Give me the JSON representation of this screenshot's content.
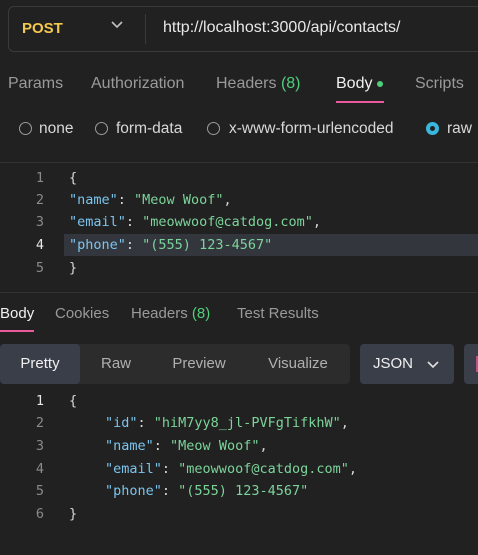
{
  "request": {
    "method": "POST",
    "url": "http://localhost:3000/api/contacts/"
  },
  "request_tabs": {
    "params": "Params",
    "authorization": "Authorization",
    "headers": "Headers",
    "headers_count": "(8)",
    "body": "Body",
    "scripts": "Scripts"
  },
  "body_types": {
    "none": "none",
    "form_data": "form-data",
    "urlencoded": "x-www-form-urlencoded",
    "raw": "raw",
    "selected": "raw"
  },
  "request_body": {
    "line_numbers": [
      "1",
      "2",
      "3",
      "4",
      "5"
    ],
    "open": "{",
    "name_key": "\"name\"",
    "name_val": "\"Meow Woof\"",
    "email_key": "\"email\"",
    "email_val": "\"meowwoof@catdog.com\"",
    "phone_key": "\"phone\"",
    "phone_val": "\"(555) 123-4567\"",
    "close": "}"
  },
  "response_tabs": {
    "body": "Body",
    "cookies": "Cookies",
    "headers": "Headers",
    "headers_count": "(8)",
    "test_results": "Test Results"
  },
  "view_modes": {
    "pretty": "Pretty",
    "raw": "Raw",
    "preview": "Preview",
    "visualize": "Visualize",
    "selected": "Pretty",
    "format": "JSON"
  },
  "response_body": {
    "line_numbers": [
      "1",
      "2",
      "3",
      "4",
      "5",
      "6"
    ],
    "open": "{",
    "id_key": "\"id\"",
    "id_val": "\"hiM7yy8_jl-PVFgTifkhW\"",
    "name_key": "\"name\"",
    "name_val": "\"Meow Woof\"",
    "email_key": "\"email\"",
    "email_val": "\"meowwoof@catdog.com\"",
    "phone_key": "\"phone\"",
    "phone_val": "\"(555) 123-4567\"",
    "close": "}"
  },
  "colors": {
    "method": "#f2c94c",
    "accent_underline": "#e85a9c",
    "count_green": "#4fcf7a",
    "radio_selected": "#3ab7dc",
    "json_key": "#7cc4ee",
    "json_string": "#7cd49a"
  },
  "icons": {
    "method_dropdown": "chevron-down-icon",
    "format_dropdown": "chevron-down-icon",
    "more": "more-icon"
  }
}
